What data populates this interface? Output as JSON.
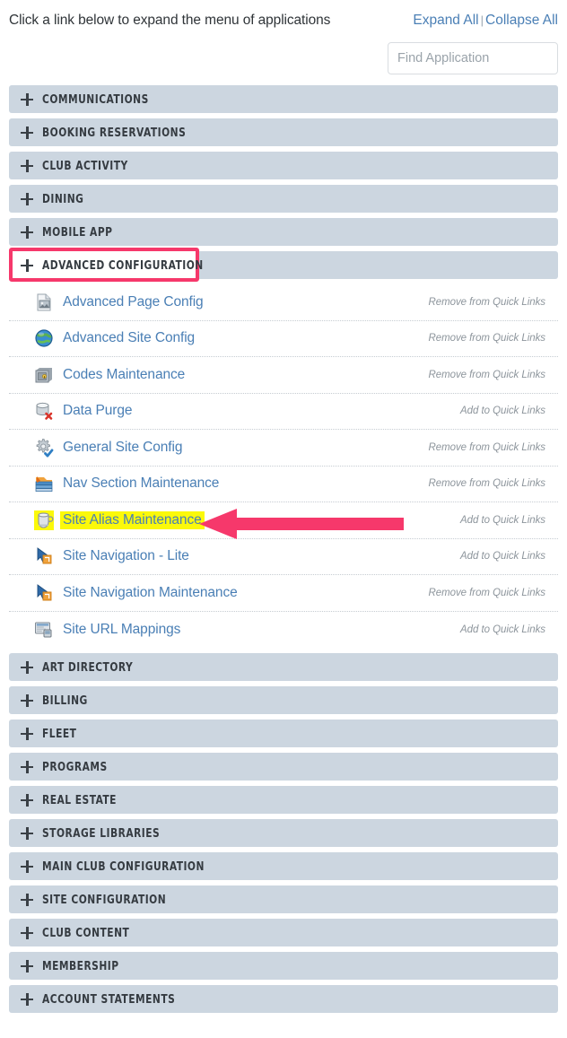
{
  "header": {
    "instruction": "Click a link below to expand the menu of applications",
    "expand_all": "Expand All",
    "separator": "|",
    "collapse_all": "Collapse All"
  },
  "search": {
    "placeholder": "Find Application",
    "value": ""
  },
  "colors": {
    "category_bar": "#ccd6e0",
    "link": "#4a7fb5",
    "annotation_red": "#f6386b",
    "highlight_yellow": "#fbf90a"
  },
  "categories": [
    {
      "label": "Communications",
      "expanded": false,
      "icon": "plus-icon"
    },
    {
      "label": "Booking Reservations",
      "expanded": false,
      "icon": "plus-icon"
    },
    {
      "label": "Club Activity",
      "expanded": false,
      "icon": "plus-icon"
    },
    {
      "label": "Dining",
      "expanded": false,
      "icon": "plus-icon"
    },
    {
      "label": "Mobile App",
      "expanded": false,
      "icon": "plus-icon"
    },
    {
      "label": "Advanced Configuration",
      "expanded": true,
      "annotated": true,
      "icon": "plus-icon"
    },
    {
      "label": "Art Directory",
      "expanded": false,
      "icon": "plus-icon"
    },
    {
      "label": "Billing",
      "expanded": false,
      "icon": "plus-icon"
    },
    {
      "label": "Fleet",
      "expanded": false,
      "icon": "plus-icon"
    },
    {
      "label": "Programs",
      "expanded": false,
      "icon": "plus-icon"
    },
    {
      "label": "Real Estate",
      "expanded": false,
      "icon": "plus-icon"
    },
    {
      "label": "Storage Libraries",
      "expanded": false,
      "icon": "plus-icon"
    },
    {
      "label": "Main Club Configuration",
      "expanded": false,
      "icon": "plus-icon"
    },
    {
      "label": "Site Configuration",
      "expanded": false,
      "icon": "plus-icon"
    },
    {
      "label": "Club Content",
      "expanded": false,
      "icon": "plus-icon"
    },
    {
      "label": "Membership",
      "expanded": false,
      "icon": "plus-icon"
    },
    {
      "label": "Account Statements",
      "expanded": false,
      "icon": "plus-icon"
    }
  ],
  "advanced_configuration_apps": [
    {
      "name": "Advanced Page Config",
      "action": "Remove from Quick Links",
      "icon": "page-image-icon",
      "highlighted": false
    },
    {
      "name": "Advanced Site Config",
      "action": "Remove from Quick Links",
      "icon": "globe-icon",
      "highlighted": false
    },
    {
      "name": "Codes Maintenance",
      "action": "Remove from Quick Links",
      "icon": "safe-vault-icon",
      "highlighted": false
    },
    {
      "name": "Data Purge",
      "action": "Add to Quick Links",
      "icon": "database-delete-icon",
      "highlighted": false
    },
    {
      "name": "General Site Config",
      "action": "Remove from Quick Links",
      "icon": "gear-check-icon",
      "highlighted": false
    },
    {
      "name": "Nav Section Maintenance",
      "action": "Remove from Quick Links",
      "icon": "layers-icon",
      "highlighted": false
    },
    {
      "name": "Site Alias Maintenance",
      "action": "Add to Quick Links",
      "icon": "cup-icon",
      "highlighted": true
    },
    {
      "name": "Site Navigation - Lite",
      "action": "Add to Quick Links",
      "icon": "arrow-cursor-icon",
      "highlighted": false
    },
    {
      "name": "Site Navigation Maintenance",
      "action": "Remove from Quick Links",
      "icon": "arrow-cursor-icon",
      "highlighted": false
    },
    {
      "name": "Site URL Mappings",
      "action": "Add to Quick Links",
      "icon": "monitor-window-icon",
      "highlighted": false
    }
  ],
  "annotations": {
    "box_target": "Advanced Configuration",
    "arrow_target": "Site Alias Maintenance"
  }
}
